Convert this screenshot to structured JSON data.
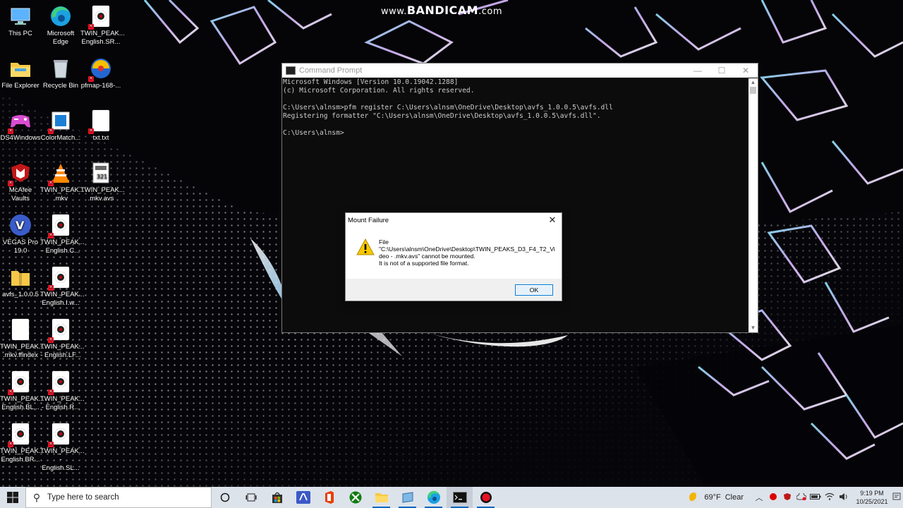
{
  "watermark": {
    "prefix": "www.",
    "brand": "BANDICAM",
    "suffix": ".com"
  },
  "desktop": {
    "icons": [
      {
        "label": "This PC",
        "icon": "this-pc-icon"
      },
      {
        "label": "Microsoft Edge",
        "icon": "edge-icon"
      },
      {
        "label": "TWIN_PEAK... English.SR...",
        "icon": "subtitle-file-icon"
      },
      {
        "label": "File Explorer",
        "icon": "folder-icon"
      },
      {
        "label": "Recycle Bin",
        "icon": "recycle-bin-icon"
      },
      {
        "label": "pfmap-168-...",
        "icon": "pfm-icon"
      },
      {
        "label": "DS4Windows",
        "icon": "gamepad-icon"
      },
      {
        "label": "ColorMatch...",
        "icon": "colormatch-icon"
      },
      {
        "label": "txt.txt",
        "icon": "text-file-icon"
      },
      {
        "label": "McAfee Vaults",
        "icon": "mcafee-icon"
      },
      {
        "label": "TWIN_PEAK... .mkv",
        "icon": "vlc-icon"
      },
      {
        "label": "TWIN_PEAK... .mkv.avs",
        "icon": "avs-script-icon"
      },
      {
        "label": "VEGAS Pro 19.0",
        "icon": "vegas-icon"
      },
      {
        "label": "TWIN_PEAK... - English.C...",
        "icon": "subtitle-file-icon"
      },
      {
        "label": "avfs_1.0.0.5",
        "icon": "zip-folder-icon"
      },
      {
        "label": "TWIN_PEAK... English.I.w...",
        "icon": "subtitle-file-icon"
      },
      {
        "label": "TWIN_PEAK... .mkv.ffindex",
        "icon": "blank-file-icon"
      },
      {
        "label": "TWIN_PEAK... - English.LF...",
        "icon": "subtitle-file-icon"
      },
      {
        "label": "TWIN_PEAK... English.BL...",
        "icon": "subtitle-file-icon"
      },
      {
        "label": "TWIN_PEAK... - English.R...",
        "icon": "subtitle-file-icon"
      },
      {
        "label": "TWIN_PEAK... English.BR...",
        "icon": "subtitle-file-icon"
      },
      {
        "label": "TWIN_PEAK... - English.SL...",
        "icon": "subtitle-file-icon"
      }
    ]
  },
  "cmd": {
    "title": "Command Prompt",
    "lines": [
      "Microsoft Windows [Version 10.0.19042.1288]",
      "(c) Microsoft Corporation. All rights reserved.",
      "",
      "C:\\Users\\alnsm>pfm register C:\\Users\\alnsm\\OneDrive\\Desktop\\avfs_1.0.0.5\\avfs.dll",
      "Registering formatter \"C:\\Users\\alnsm\\OneDrive\\Desktop\\avfs_1.0.0.5\\avfs.dll\".",
      "",
      "C:\\Users\\alnsm>"
    ],
    "minimize": "—",
    "maximize": "☐",
    "close": "✕"
  },
  "dialog": {
    "title": "Mount Failure",
    "close": "✕",
    "message": [
      "File",
      "\"C:\\Users\\alnsm\\OneDrive\\Desktop\\TWIN_PEAKS_D3_F4_T2_Vi",
      "deo - .mkv.avs\" cannot be mounted.",
      "It is not of a supported file format."
    ],
    "ok_label": "OK"
  },
  "taskbar": {
    "search_placeholder": "Type here to search",
    "apps": [
      "cortana-icon",
      "task-view-icon",
      "store-icon",
      "vegas-taskbar-icon",
      "office-icon",
      "xbox-icon",
      "file-explorer-icon",
      "pfm-taskbar-icon",
      "edge-taskbar-icon",
      "cmd-taskbar-icon",
      "bandicam-record-icon"
    ],
    "weather": {
      "temp": "69°F",
      "condition": "Clear"
    },
    "time": "9:19 PM",
    "date": "10/25/2021"
  }
}
